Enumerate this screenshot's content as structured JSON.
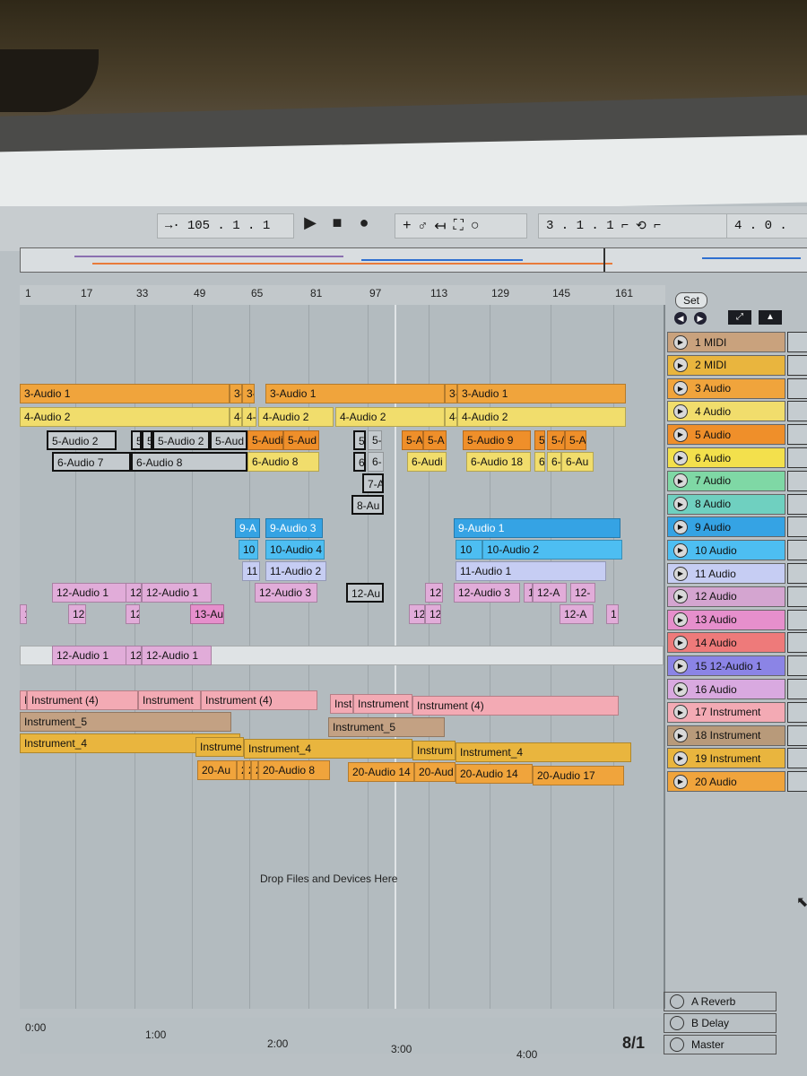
{
  "transport": {
    "tempo": "105 . 1 . 1",
    "play_icon": "play-icon",
    "stop_icon": "stop-icon",
    "record_icon": "record-icon",
    "loop_start": "3 . 1 . 1",
    "loop_length": "4 . 0 ."
  },
  "ruler": [
    "1",
    "17",
    "33",
    "49",
    "65",
    "81",
    "97",
    "113",
    "129",
    "145",
    "161"
  ],
  "set_label": "Set",
  "drop_hint": "Drop Files and Devices Here",
  "time_marks": [
    "0:00",
    "1:00",
    "2:00",
    "3:00",
    "4:00"
  ],
  "page_indicator": "8/1",
  "tracks": [
    {
      "name": "1 MIDI",
      "color": "#c9a27d"
    },
    {
      "name": "2 MIDI",
      "color": "#e9b53e"
    },
    {
      "name": "3 Audio",
      "color": "#f0a43c"
    },
    {
      "name": "4 Audio",
      "color": "#f1dd6c"
    },
    {
      "name": "5 Audio",
      "color": "#ef8f2a"
    },
    {
      "name": "6 Audio",
      "color": "#f3e04c"
    },
    {
      "name": "7 Audio",
      "color": "#7fd8a5"
    },
    {
      "name": "8 Audio",
      "color": "#6fd0c0"
    },
    {
      "name": "9 Audio",
      "color": "#35a3e4"
    },
    {
      "name": "10 Audio",
      "color": "#4dbef2"
    },
    {
      "name": "11 Audio",
      "color": "#c6cdf3"
    },
    {
      "name": "12 Audio",
      "color": "#d4a5d0"
    },
    {
      "name": "13 Audio",
      "color": "#e68fcc"
    },
    {
      "name": "14 Audio",
      "color": "#ee7a7a"
    },
    {
      "name": "15 12-Audio 1",
      "color": "#8b84e6"
    },
    {
      "name": "16 Audio",
      "color": "#d9a9e0"
    },
    {
      "name": "17 Instrument",
      "color": "#f3aab4"
    },
    {
      "name": "18 Instrument",
      "color": "#b89a7a"
    },
    {
      "name": "19 Instrument",
      "color": "#e9b53e"
    },
    {
      "name": "20 Audio",
      "color": "#f0a43c"
    }
  ],
  "returns": [
    {
      "name": "A Reverb",
      "color": "#e87ad0"
    },
    {
      "name": "B Delay",
      "color": "#8b84e6"
    },
    {
      "name": "Master",
      "color": "#f3aab4"
    }
  ],
  "clips": {
    "r3": [
      "3-Audio 1",
      "3-",
      "3-",
      "3-Audio 1",
      "3-",
      "3-Audio 1"
    ],
    "r4": [
      "4-Audio 2",
      "4-",
      "4-",
      "4-Audio 2",
      "4-Audio 2",
      "4-",
      "4-Audio 2"
    ],
    "r5": [
      "5-Audio 2",
      "5",
      "5",
      "5-Audio 2",
      "5-Aud",
      "5-Audi",
      "5-Aud",
      "5",
      "5-",
      "5-A",
      "5-A",
      "5-Audio 9",
      "5",
      "5-/",
      "5-A"
    ],
    "r6": [
      "6-Audio 7",
      "6-Audio 8",
      "6-Audio 8",
      "6",
      "6-",
      "6-Audi",
      "6-Audio 18",
      "6",
      "6-",
      "6-Au"
    ],
    "r7": [
      "7-A"
    ],
    "r8": [
      "8-Au"
    ],
    "r9": [
      "9-A",
      "9-Audio 3",
      "9-Audio 1"
    ],
    "r10": [
      "10",
      "10-Audio 4",
      "10",
      "10-Audio 2"
    ],
    "r11": [
      "11",
      "11-Audio 2",
      "11-Audio 1"
    ],
    "r12": [
      "12-Audio 1",
      "12",
      "12-Audio 1",
      "12-Audio 3",
      "12-Au",
      "12",
      "12-Audio 3",
      "1",
      "12-A",
      "12-"
    ],
    "r13": [
      "1",
      "12",
      "12",
      "13-Au",
      "12",
      "12",
      "12-A",
      "1"
    ],
    "r15": [
      "12-Audio 1",
      "12",
      "12-Audio 1"
    ],
    "r17": [
      "I",
      "Instrument (4)",
      "Instrument",
      "Instrument (4)",
      "Inst",
      "Instrument",
      "Instrument (4)"
    ],
    "r18": [
      "Instrument_5",
      "Instrument_5"
    ],
    "r19": [
      "Instrument_4",
      "Instrume",
      "Instrument_4",
      "Instrum",
      "Instrument_4"
    ],
    "r20": [
      "20-Au",
      "2",
      "2",
      "2",
      "20-Audio 8",
      "20-Audio 14",
      "20-Aud",
      "20-Audio 14",
      "20-Audio 17"
    ]
  }
}
